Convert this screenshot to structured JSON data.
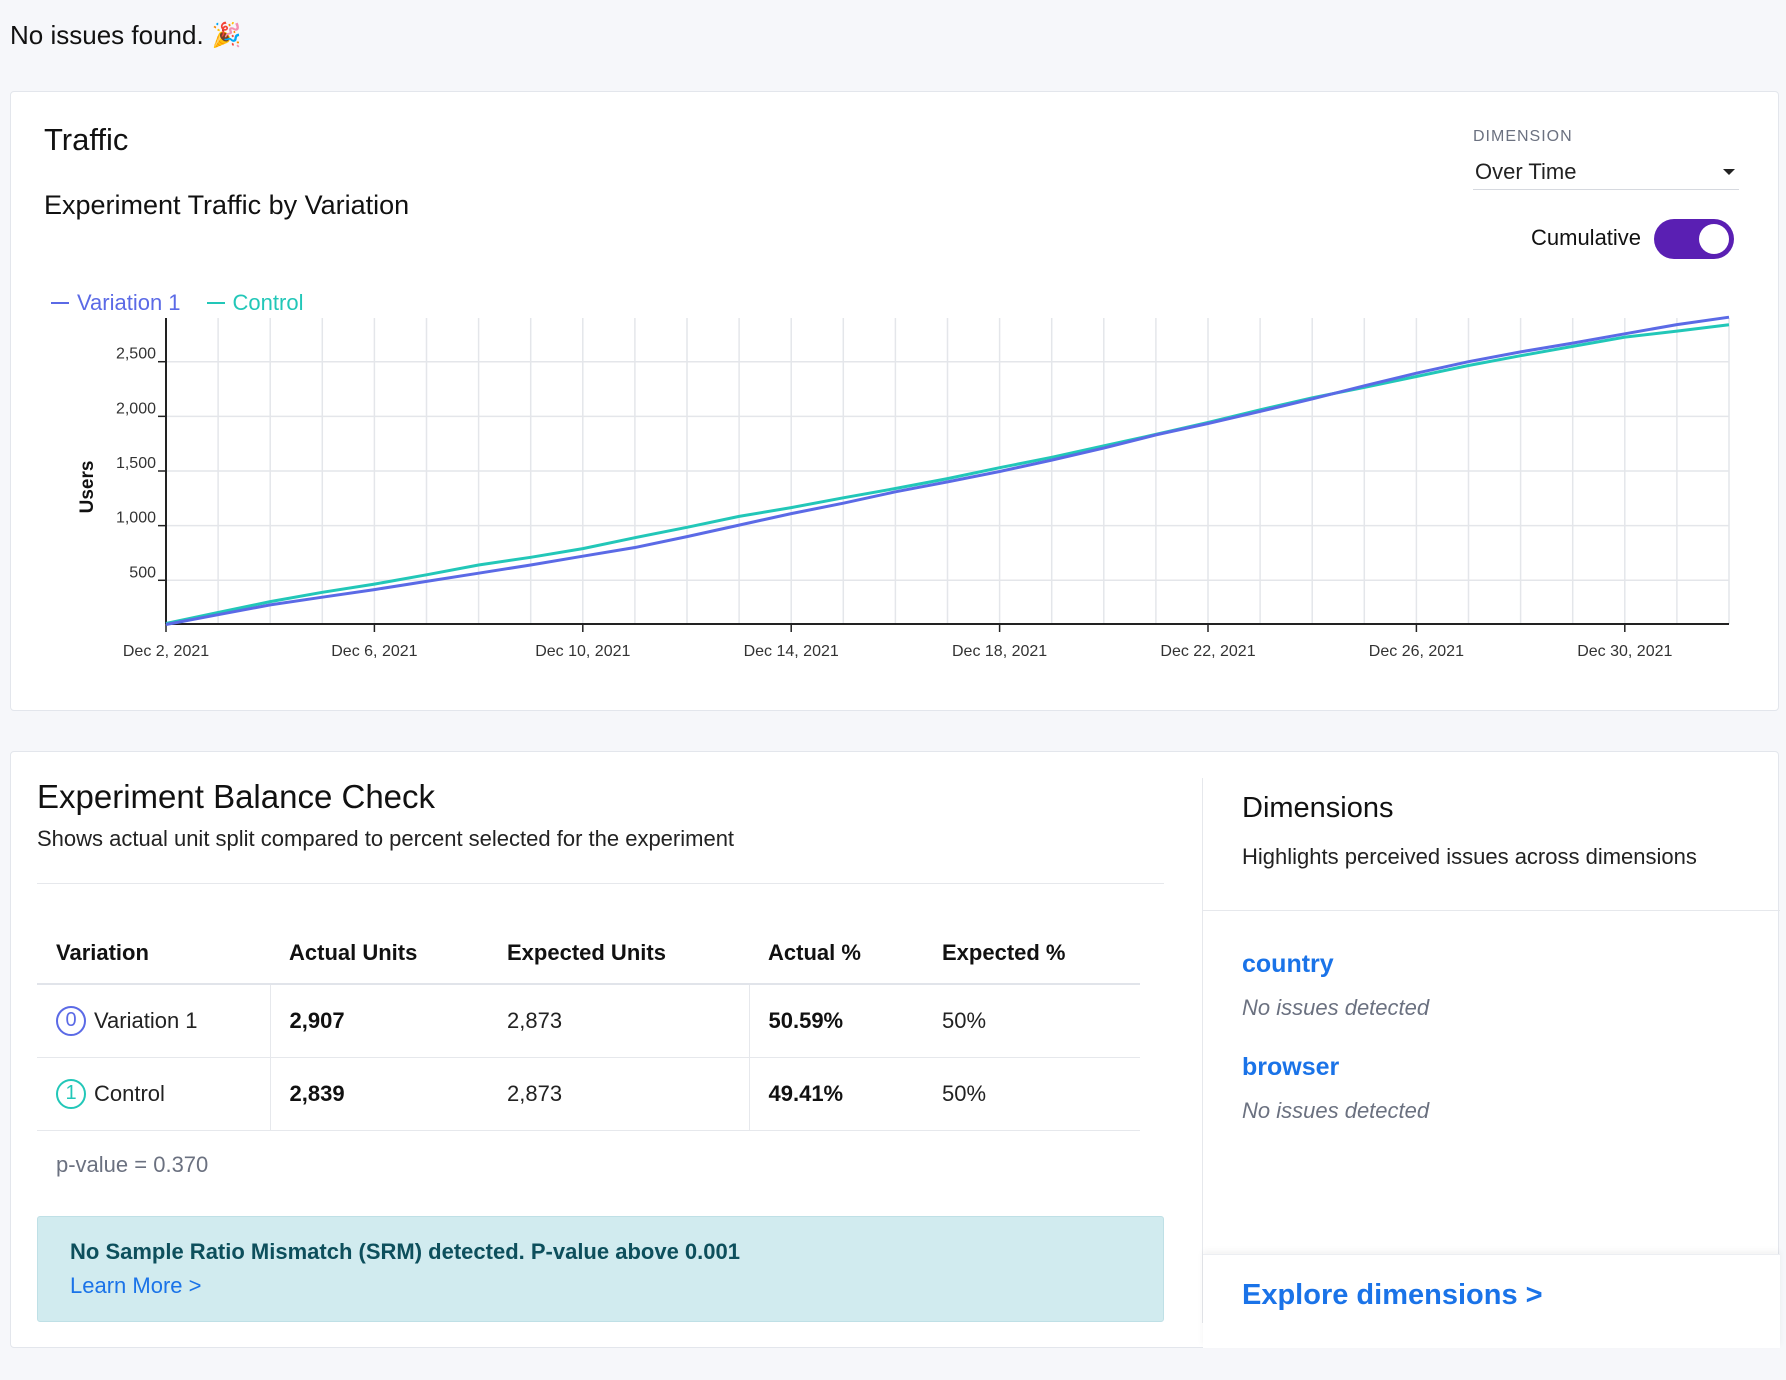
{
  "banner": {
    "text": "No issues found.",
    "emoji": "🎉"
  },
  "traffic": {
    "title": "Traffic",
    "subtitle": "Experiment Traffic by Variation",
    "dimension": {
      "label": "DIMENSION",
      "value": "Over Time"
    },
    "cumulative_label": "Cumulative",
    "cumulative_on": true
  },
  "chart_data": {
    "type": "line",
    "title": "",
    "xlabel": "",
    "ylabel": "Users",
    "x_ticks": [
      "Dec 2, 2021",
      "Dec 6, 2021",
      "Dec 10, 2021",
      "Dec 14, 2021",
      "Dec 18, 2021",
      "Dec 22, 2021",
      "Dec 26, 2021",
      "Dec 30, 2021"
    ],
    "y_ticks": [
      500,
      1000,
      1500,
      2000,
      2500
    ],
    "ylim": [
      100,
      2900
    ],
    "x": [
      "Dec 2",
      "Dec 3",
      "Dec 4",
      "Dec 5",
      "Dec 6",
      "Dec 7",
      "Dec 8",
      "Dec 9",
      "Dec 10",
      "Dec 11",
      "Dec 12",
      "Dec 13",
      "Dec 14",
      "Dec 15",
      "Dec 16",
      "Dec 17",
      "Dec 18",
      "Dec 19",
      "Dec 20",
      "Dec 21",
      "Dec 22",
      "Dec 23",
      "Dec 24",
      "Dec 25",
      "Dec 26",
      "Dec 27",
      "Dec 28",
      "Dec 29",
      "Dec 30",
      "Dec 31",
      "Jan 1"
    ],
    "legend_position": "top-left",
    "grid": true,
    "series": [
      {
        "name": "Variation 1",
        "color": "#5b6ae6",
        "values": [
          95,
          185,
          275,
          345,
          415,
          490,
          565,
          640,
          720,
          800,
          900,
          1005,
          1110,
          1205,
          1310,
          1400,
          1495,
          1600,
          1710,
          1830,
          1935,
          2045,
          2160,
          2280,
          2395,
          2500,
          2590,
          2670,
          2755,
          2840,
          2907
        ]
      },
      {
        "name": "Control",
        "color": "#22c7b8",
        "values": [
          105,
          205,
          305,
          390,
          465,
          550,
          640,
          710,
          790,
          890,
          985,
          1085,
          1165,
          1255,
          1340,
          1430,
          1530,
          1625,
          1730,
          1835,
          1945,
          2060,
          2170,
          2265,
          2365,
          2465,
          2555,
          2640,
          2725,
          2780,
          2839
        ]
      }
    ]
  },
  "balance": {
    "title": "Experiment Balance Check",
    "description": "Shows actual unit split compared to percent selected for the experiment",
    "columns": [
      "Variation",
      "Actual Units",
      "Expected Units",
      "Actual %",
      "Expected %"
    ],
    "rows": [
      {
        "index": "0",
        "name": "Variation 1",
        "actual_units": "2,907",
        "expected_units": "2,873",
        "actual_pct": "50.59%",
        "expected_pct": "50%",
        "color": "#5b6ae6"
      },
      {
        "index": "1",
        "name": "Control",
        "actual_units": "2,839",
        "expected_units": "2,873",
        "actual_pct": "49.41%",
        "expected_pct": "50%",
        "color": "#22c7b8"
      }
    ],
    "p_value": "p-value = 0.370",
    "srm_message": "No Sample Ratio Mismatch (SRM) detected. P-value above 0.001",
    "learn_more": "Learn More >"
  },
  "dimensions": {
    "title": "Dimensions",
    "description": "Highlights perceived issues across dimensions",
    "items": [
      {
        "name": "country",
        "status": "No issues detected"
      },
      {
        "name": "browser",
        "status": "No issues detected"
      }
    ],
    "explore_link": "Explore dimensions >"
  }
}
